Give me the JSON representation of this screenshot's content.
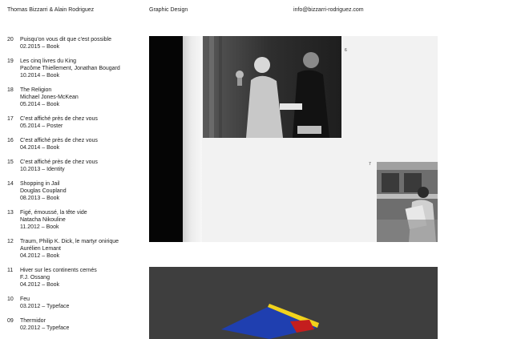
{
  "header": {
    "name": "Thomas Bizzarri & Alain Rodriguez",
    "field": "Graphic Design",
    "email": "info@bizzarri-rodriguez.com"
  },
  "projects": [
    {
      "num": "20",
      "lines": [
        "Puisqu'on vous dit que c'est possible"
      ],
      "meta": "02.2015 – Book"
    },
    {
      "num": "19",
      "lines": [
        "Les cinq livres du King",
        "Pacôme Thiellement, Jonathan Bougard"
      ],
      "meta": "10.2014 – Book"
    },
    {
      "num": "18",
      "lines": [
        "The Religion",
        "Michael Jones-McKean"
      ],
      "meta": "05.2014 – Book"
    },
    {
      "num": "17",
      "lines": [
        "C'est affiché près de chez vous"
      ],
      "meta": "05.2014 – Poster"
    },
    {
      "num": "16",
      "lines": [
        "C'est affiché près de chez vous"
      ],
      "meta": "04.2014 – Book"
    },
    {
      "num": "15",
      "lines": [
        "C'est affiché près de chez vous"
      ],
      "meta": "10.2013 – Identity"
    },
    {
      "num": "14",
      "lines": [
        "Shopping in Jail",
        "Douglas Coupland"
      ],
      "meta": "08.2013 – Book"
    },
    {
      "num": "13",
      "lines": [
        "Figé, émoussé, la tête vide",
        "Natacha Nikouline"
      ],
      "meta": "11.2012 – Book"
    },
    {
      "num": "12",
      "lines": [
        "Traum, Philip K. Dick, le martyr onirique",
        "Aurélien Lemant"
      ],
      "meta": "04.2012 – Book"
    },
    {
      "num": "11",
      "lines": [
        "Hiver sur les continents cernés",
        "F.J. Ossang"
      ],
      "meta": "04.2012 – Book"
    },
    {
      "num": "10",
      "lines": [
        "Feu"
      ],
      "meta": "03.2012 – Typeface"
    },
    {
      "num": "09",
      "lines": [
        "Thermidor"
      ],
      "meta": "02.2012 – Typeface"
    }
  ],
  "spread": {
    "fig_numbers": [
      "6",
      "7"
    ]
  }
}
